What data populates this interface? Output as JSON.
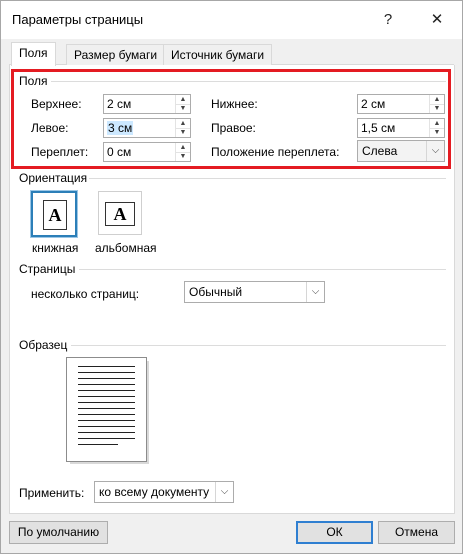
{
  "window": {
    "title": "Параметры страницы",
    "help_glyph": "?",
    "close_glyph": "✕"
  },
  "tabs": [
    "Поля",
    "Размер бумаги",
    "Источник бумаги"
  ],
  "margins": {
    "group_label": "Поля",
    "top_label": "Верхнее:",
    "top_value": "2 см",
    "bottom_label": "Нижнее:",
    "bottom_value": "2 см",
    "left_label": "Левое:",
    "left_value": "3 см",
    "right_label": "Правое:",
    "right_value": "1,5 см",
    "gutter_label": "Переплет:",
    "gutter_value": "0 см",
    "gutter_pos_label": "Положение переплета:",
    "gutter_pos_value": "Слева"
  },
  "orientation": {
    "group_label": "Ориентация",
    "portrait_label": "книжная",
    "landscape_label": "альбомная",
    "icon_letter": "A"
  },
  "pages": {
    "group_label": "Страницы",
    "multiple_label": "несколько страниц:",
    "multiple_value": "Обычный"
  },
  "preview": {
    "group_label": "Образец"
  },
  "apply": {
    "label": "Применить:",
    "value": "ко всему документу"
  },
  "buttons": {
    "default_label": "По умолчанию",
    "ok_label": "ОК",
    "cancel_label": "Отмена"
  },
  "colors": {
    "highlight_box": "#e41b22",
    "selection_bg": "#cce8ff",
    "default_button_border": "#2f7fd1"
  },
  "icons": {
    "spin_up": "▲",
    "spin_down": "▼",
    "dropdown": "⌵"
  }
}
